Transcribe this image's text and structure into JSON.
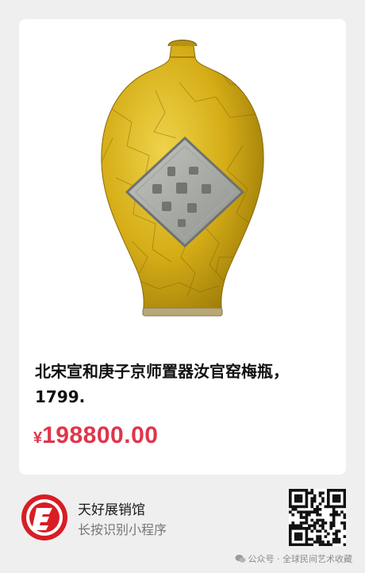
{
  "product": {
    "title": "北宋宣和庚子京师置器汝官窑梅瓶，1799.",
    "price_symbol": "¥",
    "price_value": "198800.00",
    "image_icon": "yellow-crackle-meiping-vase"
  },
  "shop": {
    "name": "天好展销馆",
    "subtitle": "长按识别小程序",
    "logo_icon": "red-circle-logo-icon",
    "qr_icon": "qr-code-icon"
  },
  "watermark": {
    "text": "公众号 · 全球民间艺术收藏",
    "icon": "wechat-official-account-icon"
  },
  "colors": {
    "price": "#e0354a",
    "background": "#efefef",
    "card": "#ffffff",
    "vase": "#d8b11a"
  }
}
